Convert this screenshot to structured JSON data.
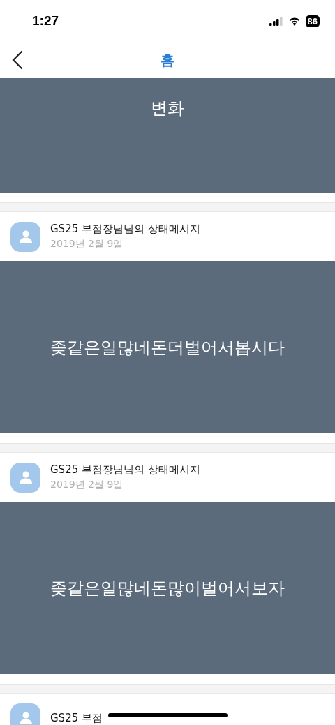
{
  "status_bar": {
    "time": "1:27",
    "battery": "86"
  },
  "nav_bar": {
    "title": "홈"
  },
  "posts": [
    {
      "kind": "cut",
      "message": "변화"
    },
    {
      "kind": "full",
      "author": "GS25 부점장님님의 상태메시지",
      "date": "2019년 2월 9일",
      "message": "좆같은일많네돈더벌어서봅시다"
    },
    {
      "kind": "full",
      "author": "GS25 부점장님님의 상태메시지",
      "date": "2019년 2월 9일",
      "message": "좆같은일많네돈많이벌어서보자"
    },
    {
      "kind": "header",
      "author": "GS25 부점"
    }
  ]
}
